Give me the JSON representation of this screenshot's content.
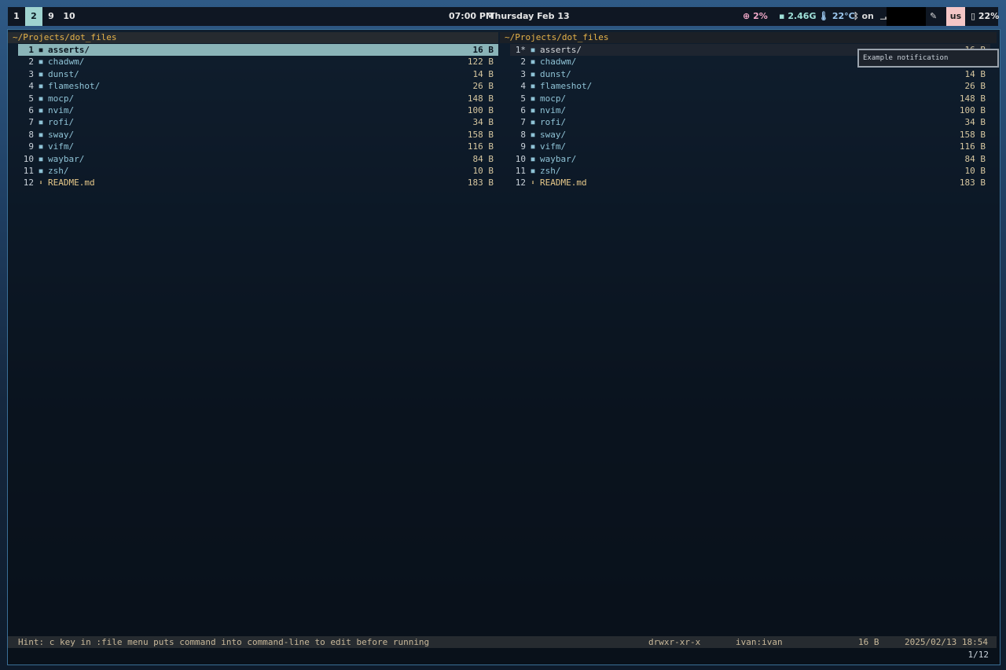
{
  "topbar": {
    "workspaces": [
      {
        "label": "1",
        "active": false
      },
      {
        "label": "2",
        "active": true
      },
      {
        "label": "9",
        "active": false
      },
      {
        "label": "10",
        "active": false
      }
    ],
    "time": "07:00 PM",
    "date": "Thursday Feb 13",
    "cpu": "2%",
    "memory": "2.46G",
    "temperature": "22°C",
    "bluetooth": "on",
    "keyboard_layout": "us",
    "battery": "22%",
    "accent_color": "#9fd3d0"
  },
  "file_manager": {
    "left_pane": {
      "path": "~/Projects/dot_files",
      "entries": [
        {
          "num": "1",
          "name": "asserts/",
          "size": "16 B",
          "type": "dir",
          "selected": true
        },
        {
          "num": "2",
          "name": "chadwm/",
          "size": "122 B",
          "type": "dir"
        },
        {
          "num": "3",
          "name": "dunst/",
          "size": "14 B",
          "type": "dir"
        },
        {
          "num": "4",
          "name": "flameshot/",
          "size": "26 B",
          "type": "dir"
        },
        {
          "num": "5",
          "name": "mocp/",
          "size": "148 B",
          "type": "dir"
        },
        {
          "num": "6",
          "name": "nvim/",
          "size": "100 B",
          "type": "dir"
        },
        {
          "num": "7",
          "name": "rofi/",
          "size": "34 B",
          "type": "dir"
        },
        {
          "num": "8",
          "name": "sway/",
          "size": "158 B",
          "type": "dir"
        },
        {
          "num": "9",
          "name": "vifm/",
          "size": "116 B",
          "type": "dir"
        },
        {
          "num": "10",
          "name": "waybar/",
          "size": "84 B",
          "type": "dir"
        },
        {
          "num": "11",
          "name": "zsh/",
          "size": "10 B",
          "type": "dir"
        },
        {
          "num": "12",
          "name": "README.md",
          "size": "183 B",
          "type": "file"
        }
      ]
    },
    "right_pane": {
      "path": "~/Projects/dot_files",
      "entries": [
        {
          "num": "1*",
          "name": "asserts/",
          "size": "16 B",
          "type": "dir",
          "selected": true
        },
        {
          "num": "2",
          "name": "chadwm/",
          "size": "122 B",
          "type": "dir"
        },
        {
          "num": "3",
          "name": "dunst/",
          "size": "14 B",
          "type": "dir"
        },
        {
          "num": "4",
          "name": "flameshot/",
          "size": "26 B",
          "type": "dir"
        },
        {
          "num": "5",
          "name": "mocp/",
          "size": "148 B",
          "type": "dir"
        },
        {
          "num": "6",
          "name": "nvim/",
          "size": "100 B",
          "type": "dir"
        },
        {
          "num": "7",
          "name": "rofi/",
          "size": "34 B",
          "type": "dir"
        },
        {
          "num": "8",
          "name": "sway/",
          "size": "158 B",
          "type": "dir"
        },
        {
          "num": "9",
          "name": "vifm/",
          "size": "116 B",
          "type": "dir"
        },
        {
          "num": "10",
          "name": "waybar/",
          "size": "84 B",
          "type": "dir"
        },
        {
          "num": "11",
          "name": "zsh/",
          "size": "10 B",
          "type": "dir"
        },
        {
          "num": "12",
          "name": "README.md",
          "size": "183 B",
          "type": "file"
        }
      ]
    },
    "status": {
      "hint": "Hint: c key in :file menu puts command into command-line to edit before running",
      "permissions": "drwxr-xr-x",
      "owner": "ivan:ivan",
      "size": "16 B",
      "modified": "2025/02/13 18:54"
    },
    "position": "1/12"
  },
  "notification": {
    "text": "Example notification"
  }
}
